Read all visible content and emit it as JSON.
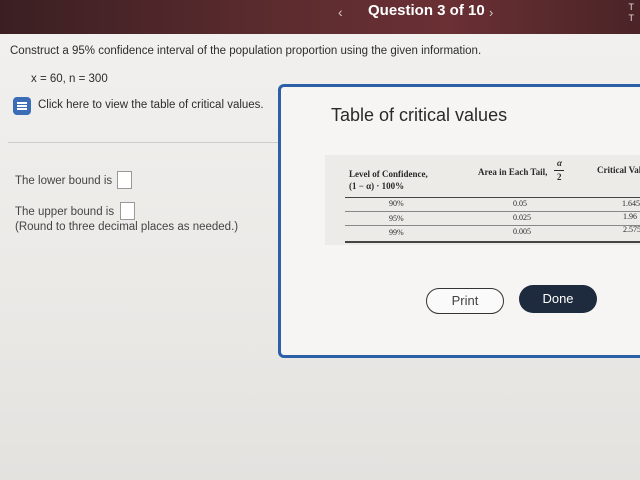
{
  "nav": {
    "prev": "‹",
    "title": "Question 3 of 10",
    "next": "›",
    "corner_1": "T",
    "corner_2": "T"
  },
  "question": {
    "prompt": "Construct a 95% confidence interval of the population proportion using the given information.",
    "given": "x = 60, n = 300",
    "hint_link": "Click here to view the table of critical values.",
    "lower_label": "The lower bound is",
    "upper_label": "The upper bound is",
    "round_note": "(Round to three decimal places as needed.)"
  },
  "modal": {
    "title": "Table of critical values",
    "headers": {
      "confidence_line1": "Level of Confidence,",
      "confidence_line2": "(1 − α) · 100%",
      "tail": "Area in Each Tail,",
      "tail_frac_num": "α",
      "tail_frac_den": "2",
      "critical": "Critical Val"
    },
    "rows": [
      {
        "confidence": "90%",
        "tail": "0.05",
        "critical": "1.645"
      },
      {
        "confidence": "95%",
        "tail": "0.025",
        "critical": "1.96"
      },
      {
        "confidence": "99%",
        "tail": "0.005",
        "critical": "2.575"
      }
    ],
    "print_label": "Print",
    "done_label": "Done"
  }
}
